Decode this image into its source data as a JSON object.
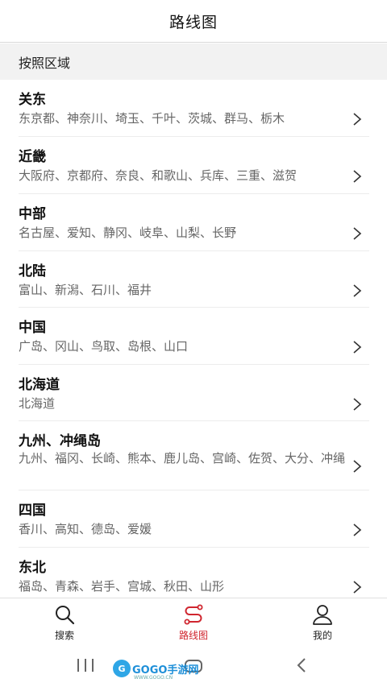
{
  "header": {
    "title": "路线图"
  },
  "section": {
    "label": "按照区域"
  },
  "regions": [
    {
      "name": "关东",
      "prefectures": "东京都、神奈川、埼玉、千叶、茨城、群马、栃木"
    },
    {
      "name": "近畿",
      "prefectures": "大阪府、京都府、奈良、和歌山、兵库、三重、滋贺"
    },
    {
      "name": "中部",
      "prefectures": "名古屋、爱知、静冈、岐阜、山梨、长野"
    },
    {
      "name": "北陆",
      "prefectures": "富山、新潟、石川、福井"
    },
    {
      "name": "中国",
      "prefectures": "广岛、冈山、鸟取、岛根、山口"
    },
    {
      "name": "北海道",
      "prefectures": "北海道"
    },
    {
      "name": "九州、冲绳岛",
      "prefectures": "九州、福冈、长崎、熊本、鹿儿岛、宫崎、佐贺、大分、冲绳"
    },
    {
      "name": "四国",
      "prefectures": "香川、高知、德岛、爱媛"
    },
    {
      "name": "东北",
      "prefectures": "福岛、青森、岩手、宫城、秋田、山形"
    }
  ],
  "tabbar": {
    "tabs": [
      {
        "label": "搜索",
        "icon": "search-icon"
      },
      {
        "label": "路线图",
        "icon": "route-icon",
        "active": true
      },
      {
        "label": "我的",
        "icon": "user-icon"
      }
    ]
  },
  "watermark": {
    "badge": "G",
    "text": "GOGO手游网",
    "sub": "WWW.GOGO.CN"
  },
  "colors": {
    "accent": "#d0262f",
    "section_bg": "#f2f2f2",
    "secondary_text": "#666666"
  }
}
